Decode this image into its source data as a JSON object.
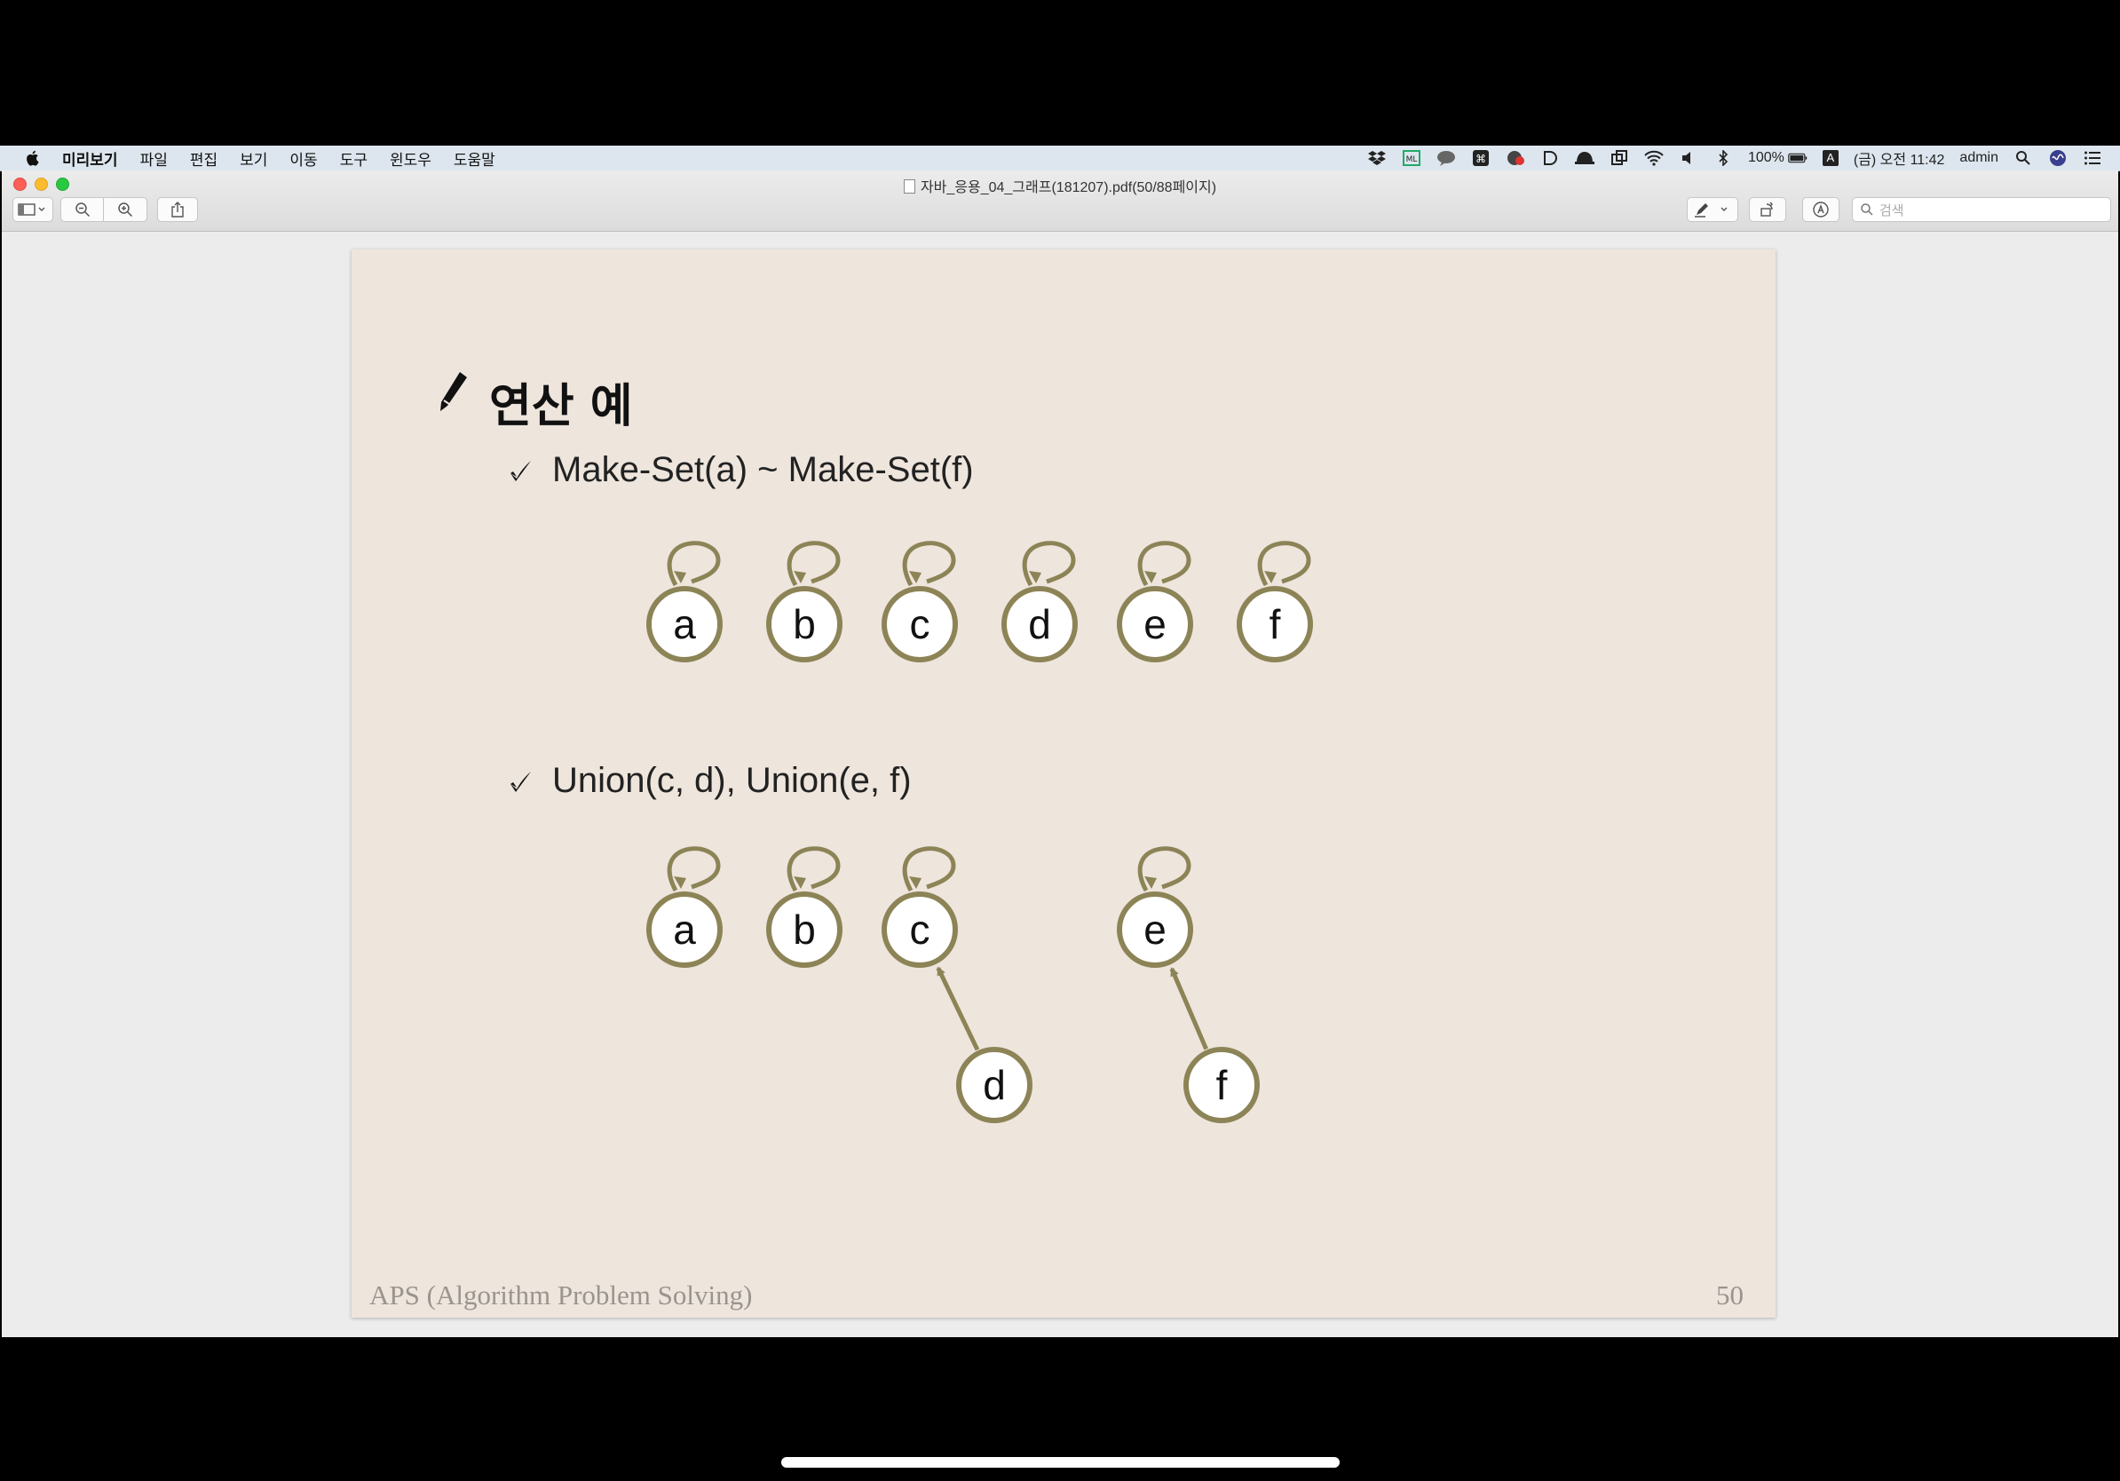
{
  "menubar": {
    "items": [
      "미리보기",
      "파일",
      "편집",
      "보기",
      "이동",
      "도구",
      "윈도우",
      "도움말"
    ],
    "status": {
      "battery": "100%",
      "input_source": "A",
      "clock": "(금) 오전 11:42",
      "user": "admin"
    }
  },
  "window": {
    "title": "자바_응용_04_그래프(181207).pdf(50/88페이지)",
    "search_placeholder": "검색"
  },
  "slide": {
    "title": "연산 예",
    "bullets": [
      "Make-Set(a) ~ Make-Set(f)",
      "Union(c, d), Union(e, f)"
    ],
    "diagram1": {
      "nodes": [
        {
          "label": "a",
          "self_loop": true
        },
        {
          "label": "b",
          "self_loop": true
        },
        {
          "label": "c",
          "self_loop": true
        },
        {
          "label": "d",
          "self_loop": true
        },
        {
          "label": "e",
          "self_loop": true
        },
        {
          "label": "f",
          "self_loop": true
        }
      ]
    },
    "diagram2": {
      "nodes": [
        {
          "label": "a",
          "self_loop": true
        },
        {
          "label": "b",
          "self_loop": true
        },
        {
          "label": "c",
          "self_loop": true
        },
        {
          "label": "e",
          "self_loop": true
        },
        {
          "label": "d",
          "self_loop": false
        },
        {
          "label": "f",
          "self_loop": false
        }
      ],
      "edges": [
        {
          "from": "d",
          "to": "c"
        },
        {
          "from": "f",
          "to": "e"
        }
      ]
    },
    "footer_left": "APS (Algorithm Problem Solving)",
    "page_number": "50"
  },
  "colors": {
    "page_background": "#eee5dd",
    "node_stroke": "#8c8456",
    "node_fill": "#ffffff",
    "menubar": "#dde6ee"
  },
  "icons": [
    "apple-icon",
    "sidebar-toggle-icon",
    "zoom-out-icon",
    "zoom-in-icon",
    "share-icon",
    "markup-pen-icon",
    "rotate-icon",
    "annotate-icon",
    "search-icon",
    "dropbox-icon",
    "wifi-icon",
    "volume-icon",
    "bluetooth-icon",
    "battery-icon",
    "spotlight-icon",
    "siri-icon",
    "notification-center-icon",
    "pencil-icon",
    "checkmark-icon"
  ]
}
